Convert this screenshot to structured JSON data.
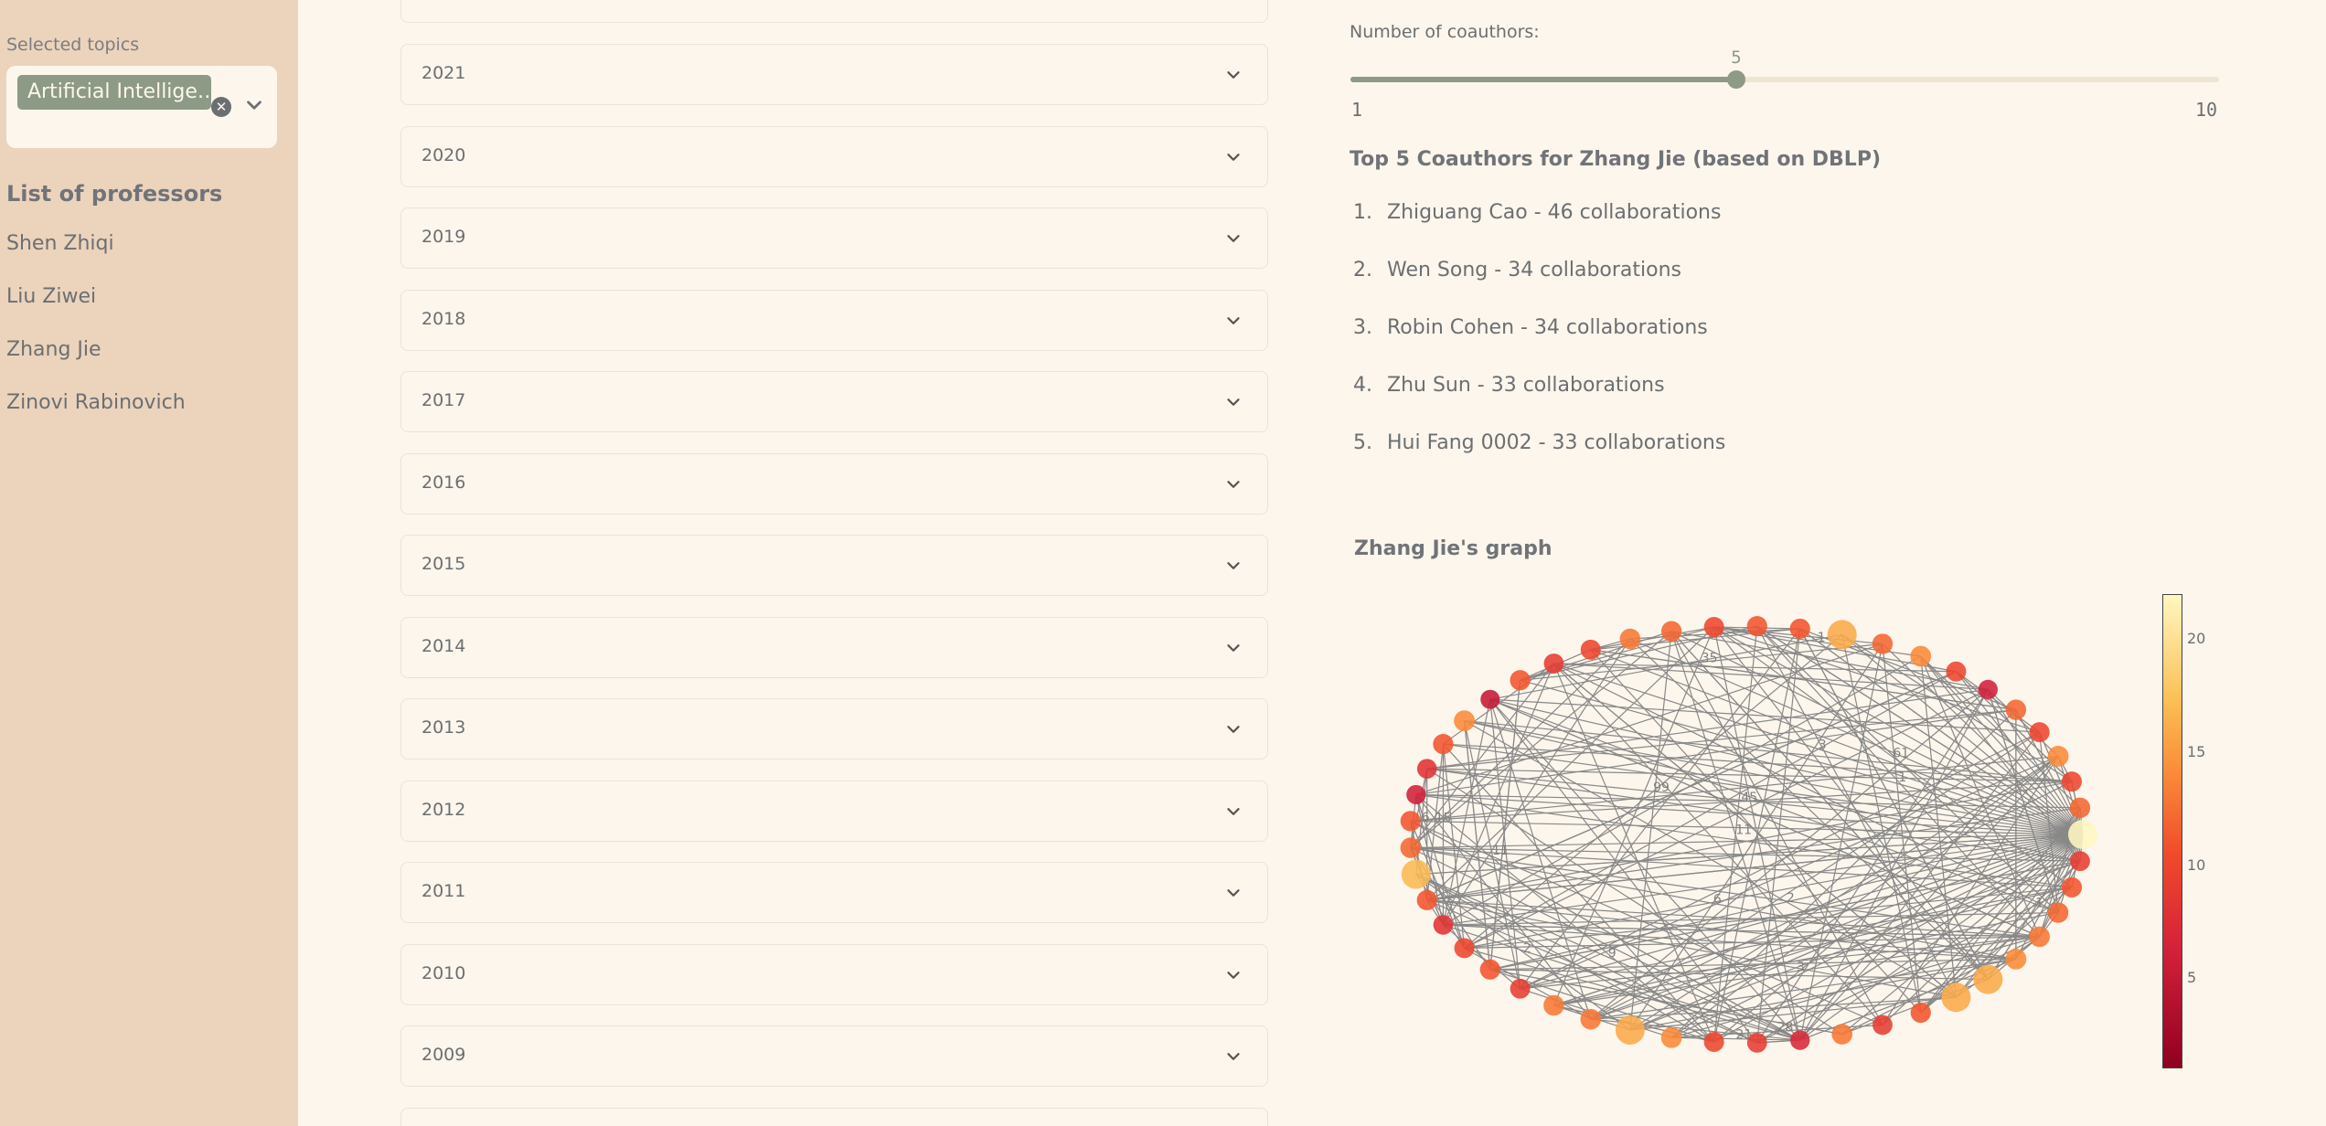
{
  "sidebar": {
    "selected_label": "Selected topics",
    "chip_label": "Artificial Intellige…",
    "clear_glyph": "✕",
    "list_title": "List of professors",
    "professors": [
      "Shen Zhiqi",
      "Liu Ziwei",
      "Zhang Jie",
      "Zinovi Rabinovich"
    ]
  },
  "years": [
    "2021",
    "2020",
    "2019",
    "2018",
    "2017",
    "2016",
    "2015",
    "2014",
    "2013",
    "2012",
    "2011",
    "2010",
    "2009"
  ],
  "slider": {
    "label": "Number of coauthors:",
    "value": "5",
    "min": "1",
    "max": "10",
    "value_num": 5,
    "min_num": 1,
    "max_num": 10
  },
  "coauthors": {
    "title": "Top 5 Coauthors for Zhang Jie (based on DBLP)",
    "items": [
      {
        "num": "1.",
        "text": "Zhiguang Cao - 46 collaborations"
      },
      {
        "num": "2.",
        "text": "Wen Song - 34 collaborations"
      },
      {
        "num": "3.",
        "text": "Robin Cohen - 34 collaborations"
      },
      {
        "num": "4.",
        "text": "Zhu Sun - 33 collaborations"
      },
      {
        "num": "5.",
        "text": "Hui Fang 0002 - 33 collaborations"
      }
    ]
  },
  "graph": {
    "title": "Zhang Jie's graph",
    "colorbar_ticks": [
      "20",
      "15",
      "10",
      "5"
    ],
    "colorbar_values": [
      20,
      15,
      10,
      5
    ],
    "colorbar_range": [
      1,
      22
    ],
    "node_count": 49,
    "node_degrees": [
      22,
      9,
      11,
      12,
      13,
      14,
      16,
      16,
      11,
      9,
      13,
      7,
      9,
      10,
      14,
      16,
      13,
      13,
      9,
      11,
      10,
      8,
      11,
      17,
      12,
      11,
      6,
      8,
      11,
      14,
      5,
      11,
      9,
      10,
      13,
      12,
      10,
      11,
      11,
      16,
      12,
      14,
      10,
      6,
      12,
      10,
      14,
      10,
      12
    ],
    "edge_labels": [
      "1",
      "2",
      "3",
      "4",
      "6",
      "9",
      "11",
      "15",
      "21",
      "28",
      "35",
      "45",
      "61",
      "99",
      "11",
      "2",
      "1",
      "3",
      "6",
      "1"
    ],
    "colors": {
      "edge": "#888888",
      "label": "#808080"
    }
  },
  "colors": {
    "sidebar_bg": "#ecd3bc",
    "main_bg": "#fdf6ec",
    "accent": "#8d9a85",
    "text": "#6b6f72"
  }
}
